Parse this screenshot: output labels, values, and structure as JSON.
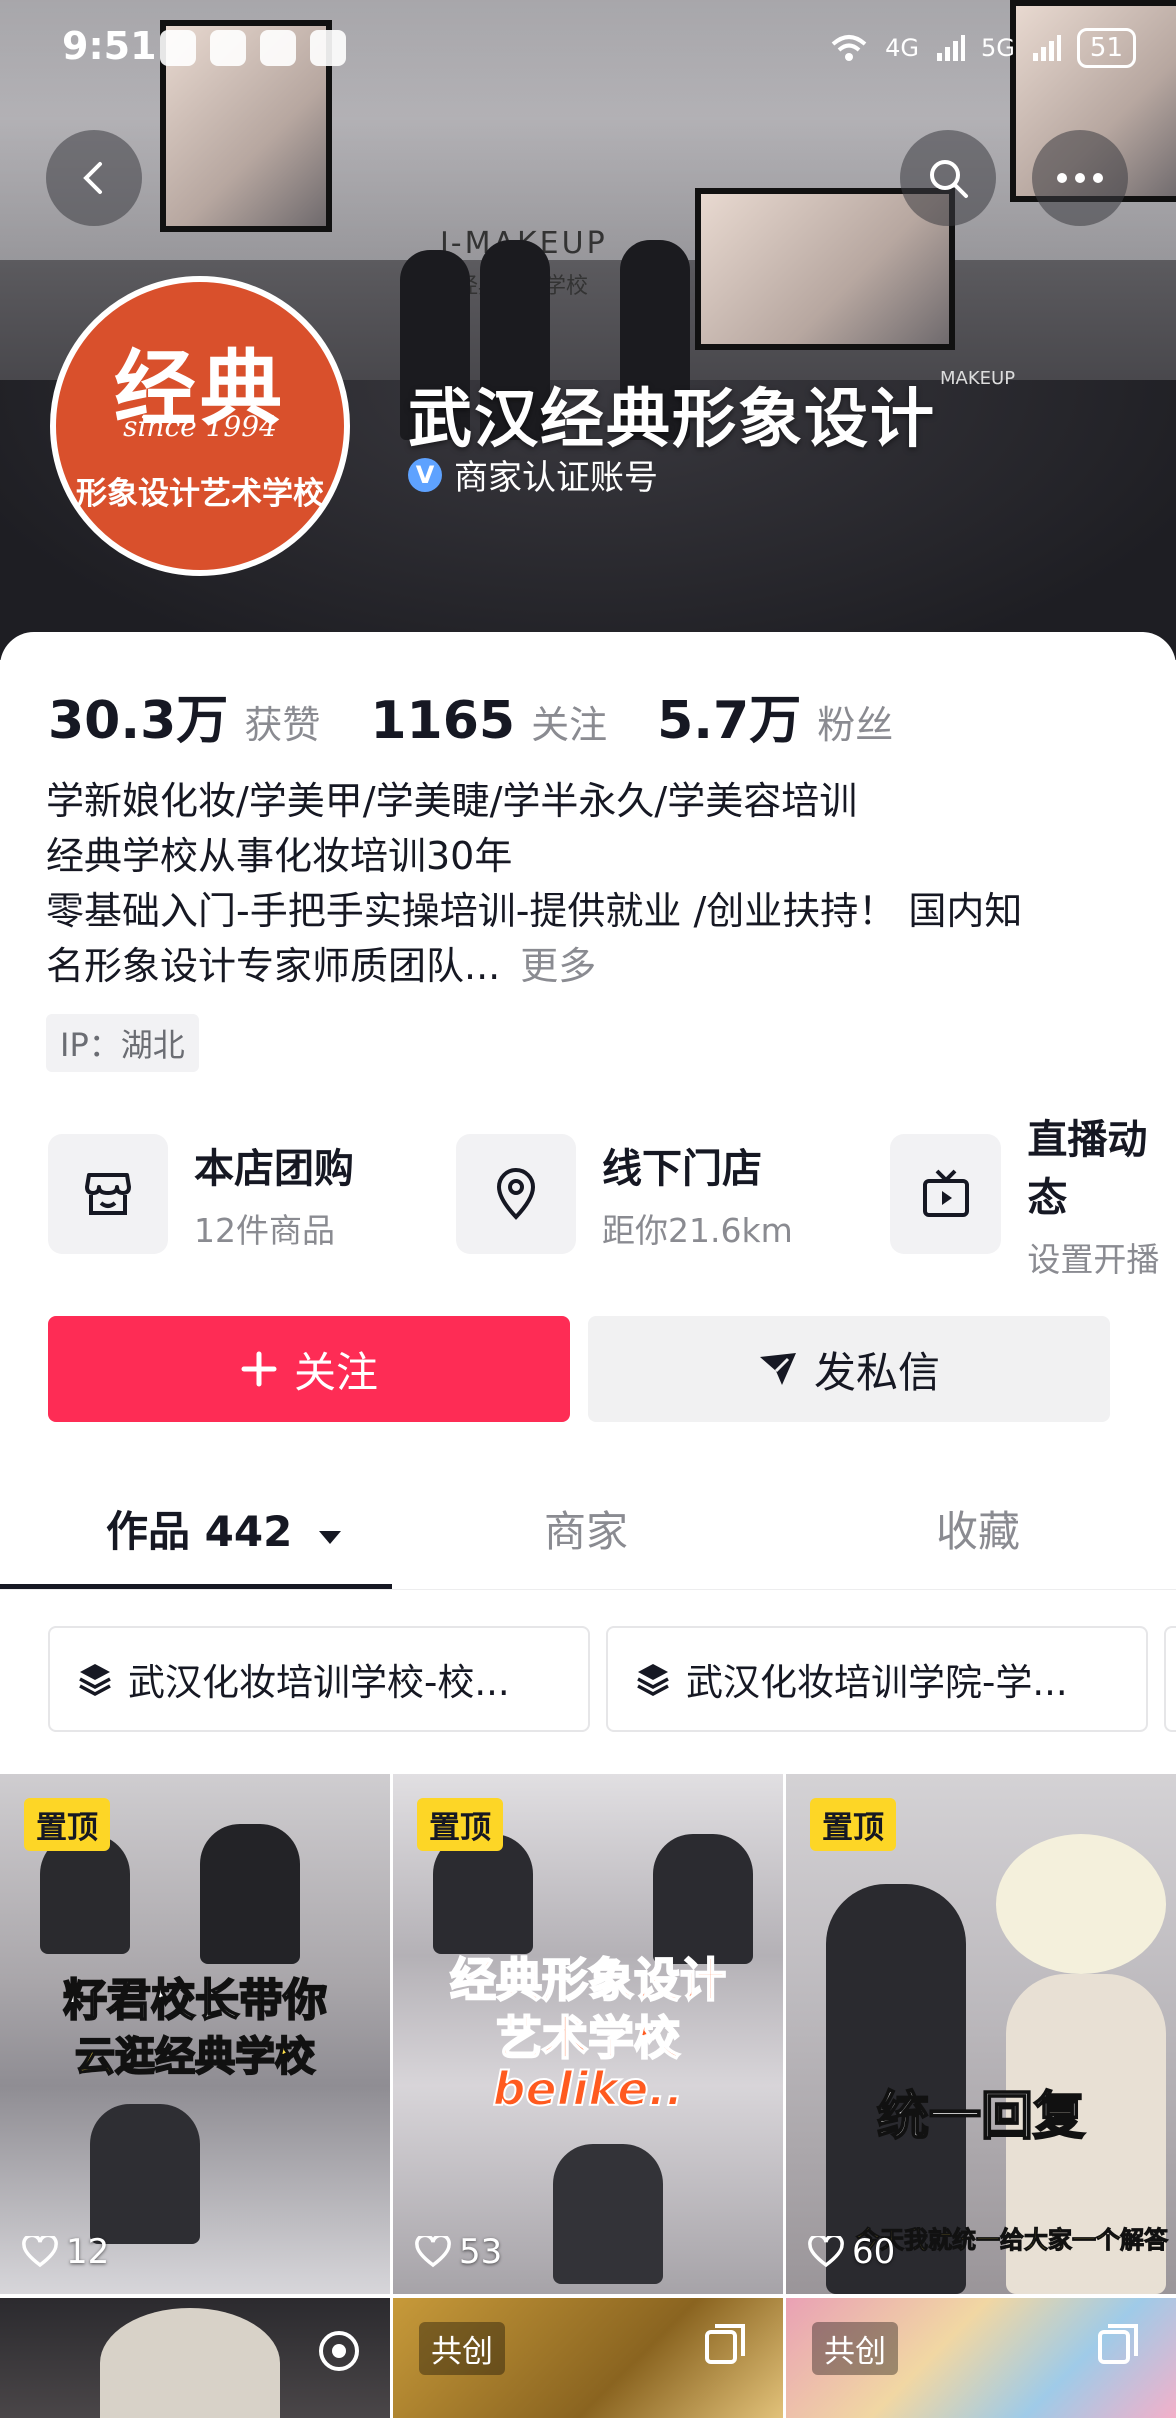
{
  "status": {
    "time": "9:51",
    "signal1": "4G",
    "signal2": "5G",
    "battery": "51"
  },
  "profile": {
    "name": "武汉经典形象设计",
    "verified_label": "商家认证账号"
  },
  "avatar": {
    "main": "经典",
    "since": "since 1994",
    "school": "形象设计艺术学校"
  },
  "banner": {
    "studio_sign": "J-MAKEUP",
    "studio_sub": "经典化妆学校",
    "screen_label": "MAKEUP"
  },
  "stats": [
    {
      "value": "30.3万",
      "label": "获赞"
    },
    {
      "value": "1165",
      "label": "关注"
    },
    {
      "value": "5.7万",
      "label": "粉丝"
    }
  ],
  "bio": {
    "line1": "学新娘化妆/学美甲/学美睫/学半永久/学美容培训",
    "line2": "经典学校从事化妆培训30年",
    "line3": "零基础入门-手把手实操培训-提供就业 /创业扶持！ 国内知",
    "line4": "名形象设计专家师质团队...",
    "more": "更多"
  },
  "ip": "IP：湖北",
  "services": [
    {
      "title": "本店团购",
      "sub": "12件商品",
      "icon": "shop-icon"
    },
    {
      "title": "线下门店",
      "sub": "距你21.6km",
      "icon": "location-pin-icon"
    },
    {
      "title": "直播动态",
      "sub": "设置开播",
      "icon": "tv-icon"
    }
  ],
  "buttons": {
    "follow": "关注",
    "message": "发私信"
  },
  "tabs": [
    {
      "label": "作品 442"
    },
    {
      "label": "商家"
    },
    {
      "label": "收藏"
    }
  ],
  "collections": [
    {
      "label": "武汉化妆培训学校-校..."
    },
    {
      "label": "武汉化妆培训学院-学..."
    }
  ],
  "videos": [
    {
      "pin": "置顶",
      "likes": "12",
      "caption1": "籽君校长带你",
      "caption2": "云逛经典学校"
    },
    {
      "pin": "置顶",
      "likes": "53",
      "caption1": "经典形象设计",
      "caption2": "艺术学校",
      "caption3": "belike.."
    },
    {
      "pin": "置顶",
      "likes": "60",
      "caption1": "统一回复",
      "caption2": "今天我就统一给大家一个解答"
    }
  ],
  "videos_row2": [
    {
      "tag": ""
    },
    {
      "tag": "共创"
    },
    {
      "tag": "共创"
    }
  ],
  "colors": {
    "accent": "#fe2c55",
    "pin": "#fdd626",
    "avatar_bg": "#d9502c",
    "verify": "#5ea2ff"
  }
}
